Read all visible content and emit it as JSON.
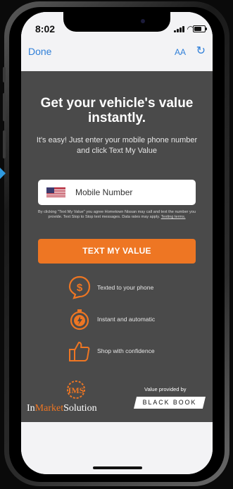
{
  "status_bar": {
    "time": "8:02"
  },
  "browser": {
    "done_label": "Done",
    "text_size_label": "AA",
    "reload_glyph": "↻"
  },
  "hero": {
    "headline_line1": "Get your vehicle's value",
    "headline_line2": "instantly.",
    "subtext": "It's easy! Just enter your mobile phone number and click Text My Value"
  },
  "form": {
    "phone_placeholder": "Mobile Number",
    "country_flag_icon": "us-flag-icon",
    "legal_text": "By clicking \"Text My Value\" you agree Hometown Nissan may call and text the number you provide. Text Stop to Stop text messages. Data rates may apply.",
    "legal_link": "Texting terms.",
    "cta_label": "TEXT MY VALUE"
  },
  "features": [
    {
      "icon": "dollar-icon",
      "label": "Texted to your phone"
    },
    {
      "icon": "stopwatch-icon",
      "label": "Instant and automatic"
    },
    {
      "icon": "thumbs-up-icon",
      "label": "Shop with confidence"
    }
  ],
  "footer": {
    "logo_initials": "IMS",
    "logo_name_prefix": "In",
    "logo_name_highlight": "Market",
    "logo_name_suffix": "Solution",
    "value_provided_label": "Value provided by",
    "provider_name": "BLACK BOOK"
  },
  "colors": {
    "accent": "#ee7623",
    "card_bg": "#4a4a4a",
    "link_blue": "#2f7fd8"
  }
}
